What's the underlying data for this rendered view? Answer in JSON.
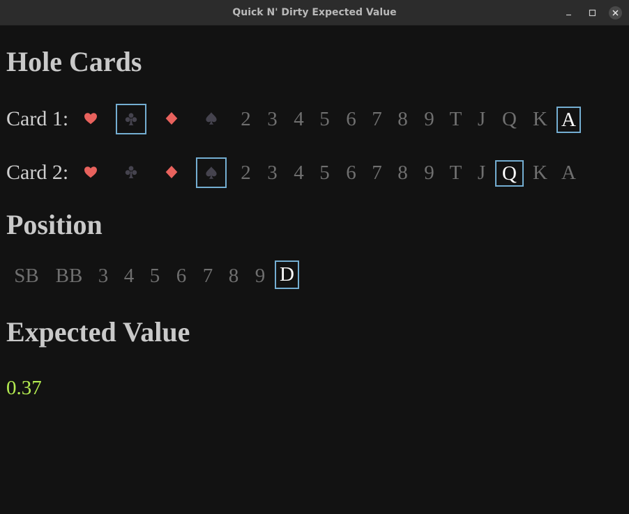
{
  "window": {
    "title": "Quick N' Dirty Expected Value"
  },
  "hole_cards": {
    "heading": "Hole Cards",
    "card1": {
      "label": "Card 1:",
      "suits": [
        {
          "name": "heart",
          "icon": "heart-icon",
          "color": "#e8625d",
          "selected": false
        },
        {
          "name": "club",
          "icon": "club-icon",
          "color": "#45434e",
          "selected": true
        },
        {
          "name": "diamond",
          "icon": "diamond-icon",
          "color": "#e8625d",
          "selected": false
        },
        {
          "name": "spade",
          "icon": "spade-icon",
          "color": "#45434e",
          "selected": false
        }
      ],
      "ranks": [
        "2",
        "3",
        "4",
        "5",
        "6",
        "7",
        "8",
        "9",
        "T",
        "J",
        "Q",
        "K",
        "A"
      ],
      "selected_rank": "A"
    },
    "card2": {
      "label": "Card 2:",
      "suits": [
        {
          "name": "heart",
          "icon": "heart-icon",
          "color": "#e8625d",
          "selected": false
        },
        {
          "name": "club",
          "icon": "club-icon",
          "color": "#45434e",
          "selected": false
        },
        {
          "name": "diamond",
          "icon": "diamond-icon",
          "color": "#e8625d",
          "selected": false
        },
        {
          "name": "spade",
          "icon": "spade-icon",
          "color": "#45434e",
          "selected": true
        }
      ],
      "ranks": [
        "2",
        "3",
        "4",
        "5",
        "6",
        "7",
        "8",
        "9",
        "T",
        "J",
        "Q",
        "K",
        "A"
      ],
      "selected_rank": "Q"
    }
  },
  "position": {
    "heading": "Position",
    "options": [
      "SB",
      "BB",
      "3",
      "4",
      "5",
      "6",
      "7",
      "8",
      "9",
      "D"
    ],
    "selected": "D"
  },
  "expected_value": {
    "heading": "Expected Value",
    "value": "0.37"
  },
  "colors": {
    "background": "#121212",
    "titlebar": "#2c2c2c",
    "selection_border": "#74aed2",
    "ev_value": "#b4ec51",
    "red_suit": "#e8625d",
    "dark_suit": "#45434e"
  }
}
